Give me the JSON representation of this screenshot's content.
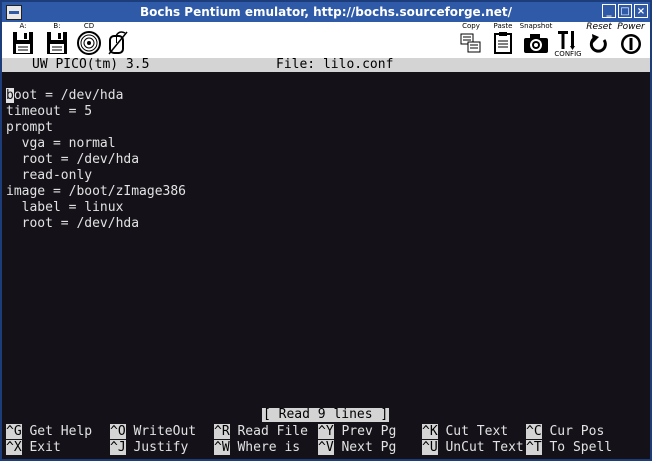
{
  "window": {
    "title": "Bochs Pentium emulator, http://bochs.sourceforge.net/"
  },
  "toolbar": {
    "drive_a_label": "A:",
    "drive_b_label": "B:",
    "cdrom_label": "CD",
    "copy_label": "Copy",
    "paste_label": "Paste",
    "snapshot_label": "Snapshot",
    "config_label": "CONFIG",
    "reset_label": "Reset",
    "power_label": "Power"
  },
  "editor": {
    "app_name": "UW PICO(tm) 3.5",
    "file_label": "File: lilo.conf",
    "first_line_cursor": "b",
    "first_line_rest": "oot = /dev/hda",
    "lines": [
      "timeout = 5",
      "prompt",
      "  vga = normal",
      "  root = /dev/hda",
      "  read-only",
      "image = /boot/zImage386",
      "  label = linux",
      "  root = /dev/hda"
    ],
    "status_message": "[ Read 9 lines ]"
  },
  "shortcuts": [
    {
      "key": "^G",
      "label": " Get Help"
    },
    {
      "key": "^O",
      "label": " WriteOut"
    },
    {
      "key": "^R",
      "label": " Read File"
    },
    {
      "key": "^Y",
      "label": " Prev Pg"
    },
    {
      "key": "^K",
      "label": " Cut Text"
    },
    {
      "key": "^C",
      "label": " Cur Pos"
    },
    {
      "key": "^X",
      "label": " Exit"
    },
    {
      "key": "^J",
      "label": " Justify"
    },
    {
      "key": "^W",
      "label": " Where is"
    },
    {
      "key": "^V",
      "label": " Next Pg"
    },
    {
      "key": "^U",
      "label": " UnCut Text"
    },
    {
      "key": "^T",
      "label": " To Spell"
    }
  ]
}
